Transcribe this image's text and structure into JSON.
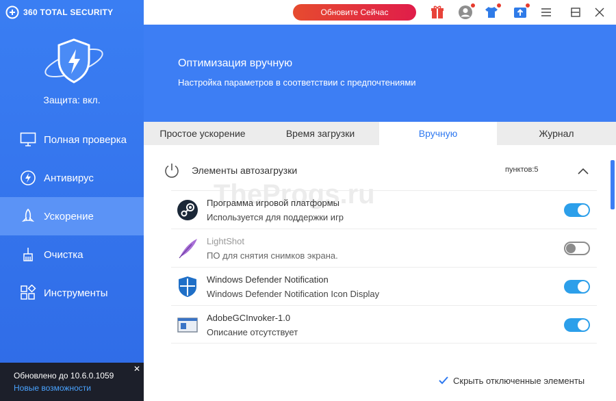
{
  "sidebar": {
    "brand": "360 TOTAL SECURITY",
    "protection_status": "Защита: вкл.",
    "items": [
      {
        "label": "Полная проверка",
        "icon": "monitor-icon"
      },
      {
        "label": "Антивирус",
        "icon": "antivirus-bolt-icon"
      },
      {
        "label": "Ускорение",
        "icon": "rocket-icon",
        "active": true
      },
      {
        "label": "Очистка",
        "icon": "broom-icon"
      },
      {
        "label": "Инструменты",
        "icon": "tools-grid-icon"
      }
    ],
    "update": {
      "version_text": "Обновлено до 10.6.0.1059",
      "link": "Новые возможности"
    }
  },
  "titlebar": {
    "upgrade_button": "Обновите Сейчас"
  },
  "banner": {
    "title": "Оптимизация вручную",
    "subtitle": "Настройка параметров в соответствии с предпочтениями"
  },
  "tabs": [
    {
      "label": "Простое ускорение"
    },
    {
      "label": "Время загрузки"
    },
    {
      "label": "Вручную",
      "active": true
    },
    {
      "label": "Журнал"
    }
  ],
  "section": {
    "title": "Элементы автозагрузки",
    "count_label": "пунктов:",
    "count_value": "5"
  },
  "items": [
    {
      "name": "Программа игровой платформы",
      "desc": "Используется для поддержки игр",
      "icon": "steam-icon",
      "enabled": true
    },
    {
      "name": "LightShot",
      "desc": "ПО для снятия снимков экрана.",
      "icon": "feather-icon",
      "enabled": false
    },
    {
      "name": "Windows Defender Notification",
      "desc": "Windows Defender Notification Icon Display",
      "icon": "defender-shield-icon",
      "enabled": true
    },
    {
      "name": "AdobeGCInvoker-1.0",
      "desc": "Описание отсутствует",
      "icon": "window-app-icon",
      "enabled": true
    }
  ],
  "footer": {
    "hide_disabled_label": "Скрыть отключенные элементы",
    "hide_disabled_checked": true
  },
  "watermark": "TheProgs.ru",
  "colors": {
    "sidebar": "#3a7ef3",
    "banner": "#3d7ef4",
    "active_tab_text": "#2f79f0",
    "toggle_on": "#2c9fea",
    "upgrade": "#e01d4a"
  }
}
